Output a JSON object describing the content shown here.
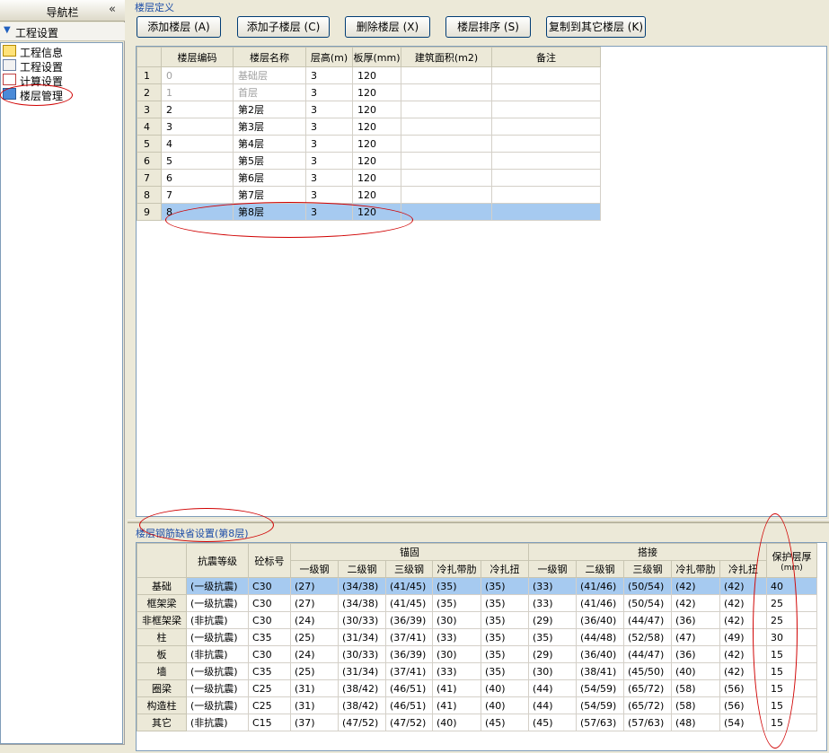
{
  "nav": {
    "title": "导航栏",
    "collapse_glyph": "«",
    "group_label": "工程设置",
    "items": [
      {
        "label": "工程信息",
        "icon": "folder-icon"
      },
      {
        "label": "工程设置",
        "icon": "document-icon"
      },
      {
        "label": "计算设置",
        "icon": "checklist-icon"
      },
      {
        "label": "楼层管理",
        "icon": "floors-icon"
      }
    ]
  },
  "floor_section": {
    "title": "楼层定义",
    "buttons": [
      "添加楼层 (A)",
      "添加子楼层 (C)",
      "删除楼层 (X)",
      "楼层排序 (S)",
      "复制到其它楼层 (K)"
    ],
    "columns": [
      "",
      "楼层编码",
      "楼层名称",
      "层高(m)",
      "板厚(mm)",
      "建筑面积(m2)",
      "备注"
    ],
    "rows": [
      [
        "1",
        "0",
        "基础层",
        "3",
        "120",
        "",
        ""
      ],
      [
        "2",
        "1",
        "首层",
        "3",
        "120",
        "",
        ""
      ],
      [
        "3",
        "2",
        "第2层",
        "3",
        "120",
        "",
        ""
      ],
      [
        "4",
        "3",
        "第3层",
        "3",
        "120",
        "",
        ""
      ],
      [
        "5",
        "4",
        "第4层",
        "3",
        "120",
        "",
        ""
      ],
      [
        "6",
        "5",
        "第5层",
        "3",
        "120",
        "",
        ""
      ],
      [
        "7",
        "6",
        "第6层",
        "3",
        "120",
        "",
        ""
      ],
      [
        "8",
        "7",
        "第7层",
        "3",
        "120",
        "",
        ""
      ],
      [
        "9",
        "8",
        "第8层",
        "3",
        "120",
        "",
        ""
      ]
    ],
    "selected_row": 9
  },
  "rebar_section": {
    "title": "楼层钢筋缺省设置(第8层)",
    "header_seismic": "抗震等级",
    "header_concrete": "砼标号",
    "group_anchor": "锚固",
    "group_lap": "搭接",
    "sub_columns": [
      "一级钢",
      "二级钢",
      "三级钢",
      "冷扎带肋",
      "冷扎扭"
    ],
    "header_cover": "保护层厚",
    "header_cover_unit": "(mm)",
    "rows": [
      {
        "name": "基础",
        "seismic": "(一级抗震)",
        "concrete": "C30",
        "anchor": [
          "(27)",
          "(34/38)",
          "(41/45)",
          "(35)",
          "(35)"
        ],
        "lap": [
          "(33)",
          "(41/46)",
          "(50/54)",
          "(42)",
          "(42)"
        ],
        "cover": "40"
      },
      {
        "name": "框架梁",
        "seismic": "(一级抗震)",
        "concrete": "C30",
        "anchor": [
          "(27)",
          "(34/38)",
          "(41/45)",
          "(35)",
          "(35)"
        ],
        "lap": [
          "(33)",
          "(41/46)",
          "(50/54)",
          "(42)",
          "(42)"
        ],
        "cover": "25"
      },
      {
        "name": "非框架梁",
        "seismic": "(非抗震)",
        "concrete": "C30",
        "anchor": [
          "(24)",
          "(30/33)",
          "(36/39)",
          "(30)",
          "(35)"
        ],
        "lap": [
          "(29)",
          "(36/40)",
          "(44/47)",
          "(36)",
          "(42)"
        ],
        "cover": "25"
      },
      {
        "name": "柱",
        "seismic": "(一级抗震)",
        "concrete": "C35",
        "anchor": [
          "(25)",
          "(31/34)",
          "(37/41)",
          "(33)",
          "(35)"
        ],
        "lap": [
          "(35)",
          "(44/48)",
          "(52/58)",
          "(47)",
          "(49)"
        ],
        "cover": "30"
      },
      {
        "name": "板",
        "seismic": "(非抗震)",
        "concrete": "C30",
        "anchor": [
          "(24)",
          "(30/33)",
          "(36/39)",
          "(30)",
          "(35)"
        ],
        "lap": [
          "(29)",
          "(36/40)",
          "(44/47)",
          "(36)",
          "(42)"
        ],
        "cover": "15"
      },
      {
        "name": "墙",
        "seismic": "(一级抗震)",
        "concrete": "C35",
        "anchor": [
          "(25)",
          "(31/34)",
          "(37/41)",
          "(33)",
          "(35)"
        ],
        "lap": [
          "(30)",
          "(38/41)",
          "(45/50)",
          "(40)",
          "(42)"
        ],
        "cover": "15"
      },
      {
        "name": "圈梁",
        "seismic": "(一级抗震)",
        "concrete": "C25",
        "anchor": [
          "(31)",
          "(38/42)",
          "(46/51)",
          "(41)",
          "(40)"
        ],
        "lap": [
          "(44)",
          "(54/59)",
          "(65/72)",
          "(58)",
          "(56)"
        ],
        "cover": "15"
      },
      {
        "name": "构造柱",
        "seismic": "(一级抗震)",
        "concrete": "C25",
        "anchor": [
          "(31)",
          "(38/42)",
          "(46/51)",
          "(41)",
          "(40)"
        ],
        "lap": [
          "(44)",
          "(54/59)",
          "(65/72)",
          "(58)",
          "(56)"
        ],
        "cover": "15"
      },
      {
        "name": "其它",
        "seismic": "(非抗震)",
        "concrete": "C15",
        "anchor": [
          "(37)",
          "(47/52)",
          "(47/52)",
          "(40)",
          "(45)"
        ],
        "lap": [
          "(45)",
          "(57/63)",
          "(57/63)",
          "(48)",
          "(54)"
        ],
        "cover": "15"
      }
    ]
  },
  "colors": {
    "selection": "#a6caf0",
    "annotation": "#d00000",
    "section_title": "#1f4fa8"
  }
}
